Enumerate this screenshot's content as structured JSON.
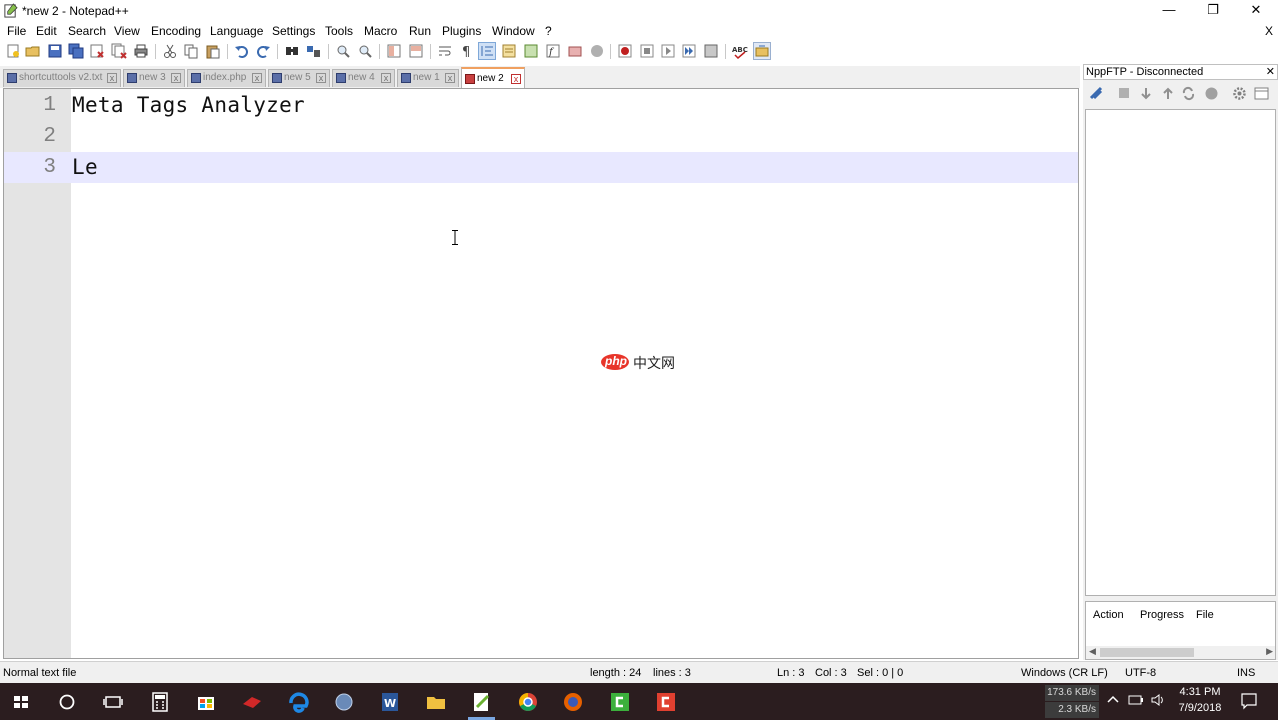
{
  "window": {
    "title": "*new 2 - Notepad++",
    "controls": {
      "minimize": "—",
      "maximize": "❐",
      "close": "✕"
    }
  },
  "menu": {
    "items": [
      "File",
      "Edit",
      "Search",
      "View",
      "Encoding",
      "Language",
      "Settings",
      "Tools",
      "Macro",
      "Run",
      "Plugins",
      "Window",
      "?"
    ],
    "close_doc": "X"
  },
  "tabs": [
    {
      "label": "shortcuttools v2.txt",
      "active": false
    },
    {
      "label": "new 3",
      "active": false
    },
    {
      "label": "index.php",
      "active": false
    },
    {
      "label": "new 5",
      "active": false
    },
    {
      "label": "new 4",
      "active": false
    },
    {
      "label": "new 1",
      "active": false
    },
    {
      "label": "new 2",
      "active": true
    }
  ],
  "editor": {
    "lines": [
      {
        "num": "1",
        "text": "Meta Tags Analyzer"
      },
      {
        "num": "2",
        "text": ""
      },
      {
        "num": "3",
        "text": "Le"
      }
    ],
    "current_line": 3,
    "colors": {
      "gutter": "#e4e4e4",
      "current_line": "#e8e8ff"
    }
  },
  "watermark": {
    "latin": "php",
    "cjk": "中文网"
  },
  "ftp": {
    "title": "NppFTP - Disconnected",
    "close": "✕",
    "queue_headers": [
      "Action",
      "Progress",
      "File"
    ]
  },
  "status": {
    "file_type": "Normal text file",
    "length": "length : 24",
    "lines": "lines : 3",
    "ln": "Ln : 3",
    "col": "Col : 3",
    "sel": "Sel : 0 | 0",
    "eol": "Windows (CR LF)",
    "encoding": "UTF-8",
    "mode": "INS"
  },
  "taskbar": {
    "net_down": "173.6 KB/s",
    "net_up": "2.3 KB/s",
    "time": "4:31 PM",
    "date": "7/9/2018"
  }
}
